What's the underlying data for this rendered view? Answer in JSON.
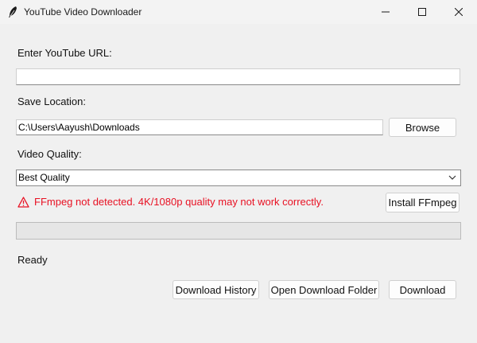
{
  "window": {
    "title": "YouTube Video Downloader",
    "icon": "feather-icon"
  },
  "url_section": {
    "label": "Enter YouTube URL:",
    "value": "",
    "placeholder": ""
  },
  "save_section": {
    "label": "Save Location:",
    "path": "C:\\Users\\Aayush\\Downloads",
    "browse_label": "Browse"
  },
  "quality_section": {
    "label": "Video Quality:",
    "selected": "Best Quality"
  },
  "warning": {
    "text": "FFmpeg not detected. 4K/1080p quality may not work correctly.",
    "icon": "warning-triangle-icon",
    "color": "#e81123",
    "install_label": "Install FFmpeg"
  },
  "progress": {
    "fraction": 0.0,
    "fill_color": "#06b025"
  },
  "status": {
    "text": "Ready"
  },
  "actions": {
    "history_label": "Download History",
    "open_folder_label": "Open Download Folder",
    "download_label": "Download"
  }
}
